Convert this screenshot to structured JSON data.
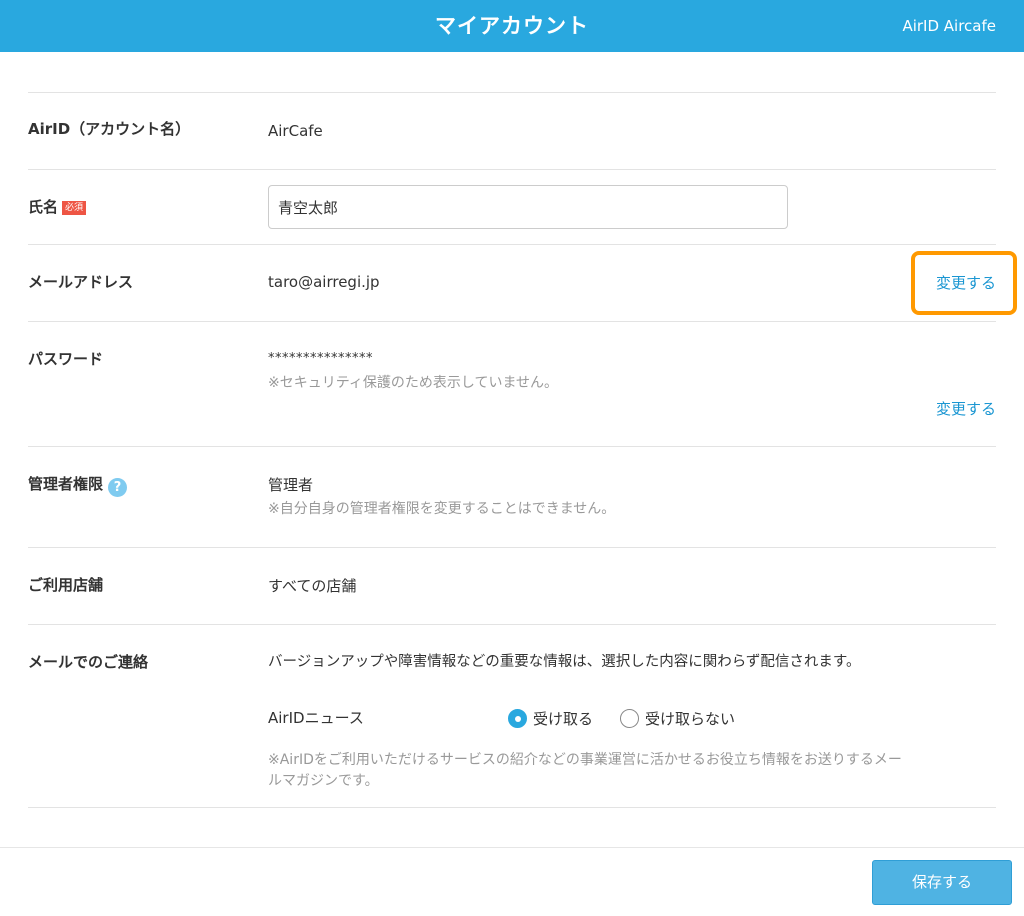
{
  "header": {
    "title": "マイアカウント",
    "account_name": "AirID Aircafe"
  },
  "form": {
    "airid": {
      "label": "AirID（アカウント名）",
      "value": "AirCafe"
    },
    "name": {
      "label": "氏名",
      "required_badge": "必須",
      "value": "青空太郎"
    },
    "email": {
      "label": "メールアドレス",
      "value": "taro@airregi.jp",
      "change_link": "変更する"
    },
    "password": {
      "label": "パスワード",
      "masked_value": "***************",
      "note": "※セキュリティ保護のため表示していません。",
      "change_link": "変更する"
    },
    "admin": {
      "label": "管理者権限",
      "help_icon": "?",
      "value": "管理者",
      "note": "※自分自身の管理者権限を変更することはできません。"
    },
    "stores": {
      "label": "ご利用店舗",
      "value": "すべての店舗"
    },
    "mail_contact": {
      "label": "メールでのご連絡",
      "description": "バージョンアップや障害情報などの重要な情報は、選択した内容に関わらず配信されます。",
      "news_label": "AirIDニュース",
      "options": [
        {
          "label": "受け取る",
          "selected": true
        },
        {
          "label": "受け取らない",
          "selected": false
        }
      ],
      "note_line1": "※AirIDをご利用いただけるサービスの紹介などの事業運営に活かせるお役立ち情報をお送りするメー",
      "note_line2": "ルマガジンです。"
    }
  },
  "footer": {
    "save_label": "保存する"
  },
  "colors": {
    "header_bg": "#29a8df",
    "link": "#1a96d2",
    "highlight": "#ff9900",
    "required_badge": "#ee5544",
    "save_button": "#4fb3e3"
  },
  "icons": [
    "help-icon",
    "radio-selected-icon",
    "radio-unselected-icon"
  ]
}
